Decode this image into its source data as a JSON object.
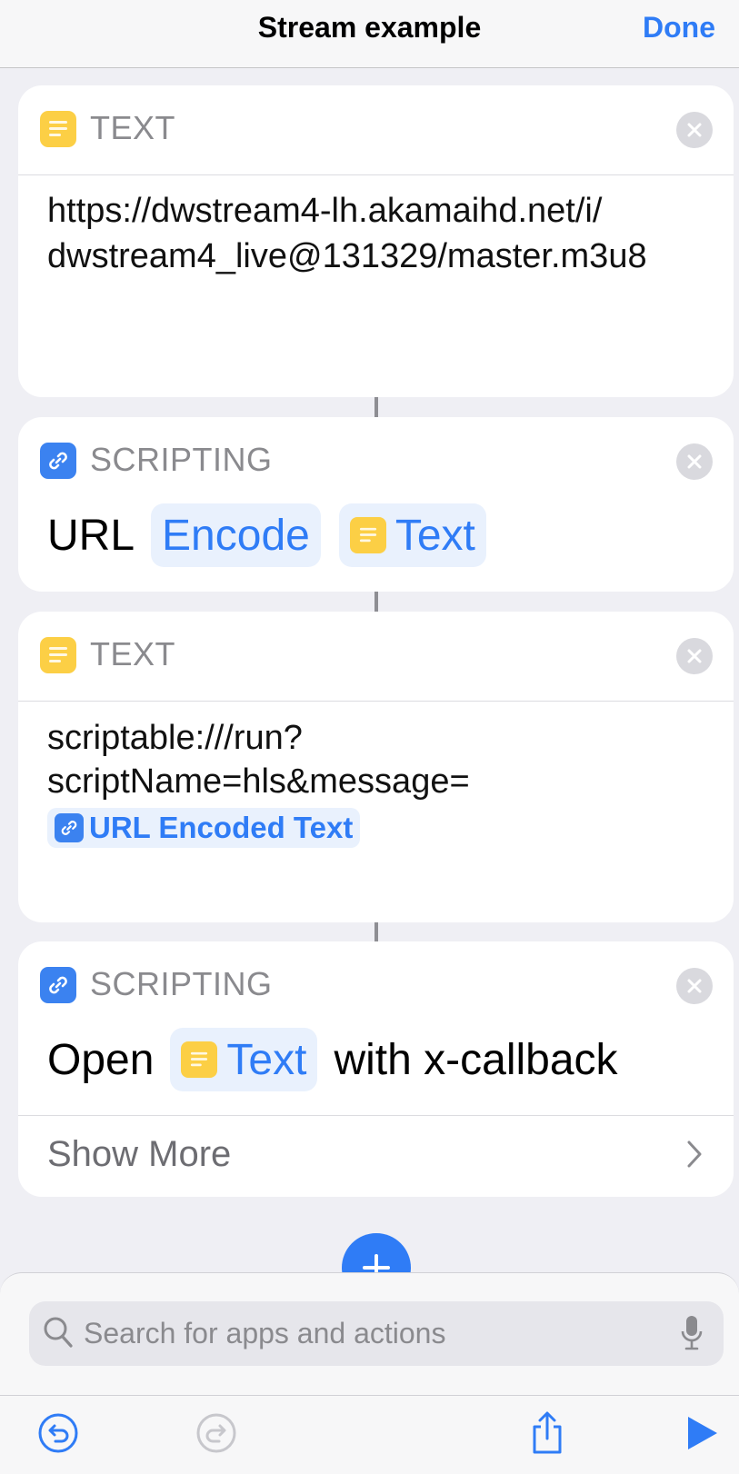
{
  "nav": {
    "title": "Stream example",
    "done_label": "Done"
  },
  "actions": [
    {
      "category": "TEXT",
      "text": "https://dwstream4-lh.akamaihd.net/i/ dwstream4_live@131329/master.m3u8"
    },
    {
      "category": "SCRIPTING",
      "word1": "URL",
      "token1": "Encode",
      "token2": "Text"
    },
    {
      "category": "TEXT",
      "line1": "scriptable:///run?",
      "line2": "scriptName=hls&message=",
      "variable": "URL Encoded Text"
    },
    {
      "category": "SCRIPTING",
      "word1": "Open",
      "token1": "Text",
      "word2": "with x-callback",
      "show_more": "Show More"
    }
  ],
  "search": {
    "placeholder": "Search for apps and actions"
  },
  "toolbar": {
    "undo": "undo-icon",
    "redo": "redo-icon",
    "share": "share-icon",
    "run": "play-icon"
  },
  "colors": {
    "accent": "#2f7cf6",
    "text_action": "#fccf45",
    "scripting_action": "#3b82f0"
  }
}
